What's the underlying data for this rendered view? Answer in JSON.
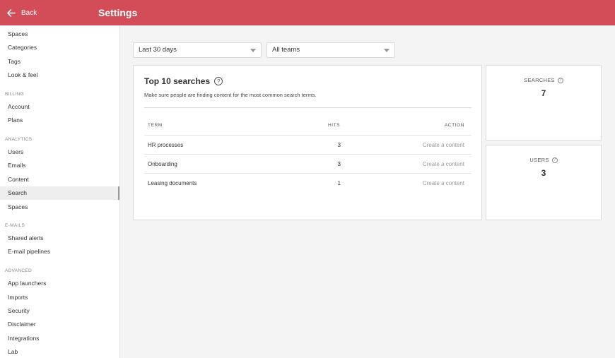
{
  "header": {
    "back_label": "Back",
    "title": "Settings"
  },
  "sidebar": {
    "general_items": [
      "Spaces",
      "Categories",
      "Tags",
      "Look & feel"
    ],
    "billing": {
      "label": "BILLING",
      "items": [
        "Account",
        "Plans"
      ]
    },
    "analytics": {
      "label": "ANALYTICS",
      "items": [
        "Users",
        "Emails",
        "Content",
        "Search",
        "Spaces"
      ]
    },
    "emails": {
      "label": "E-MAILS",
      "items": [
        "Shared alerts",
        "E-mail pipelines"
      ]
    },
    "advanced": {
      "label": "ADVANCED",
      "items": [
        "App launchers",
        "Imports",
        "Security",
        "Disclaimer",
        "Integrations",
        "Lab"
      ]
    },
    "active_item": "Search"
  },
  "filters": {
    "period": "Last 30 days",
    "team": "All teams"
  },
  "top_searches": {
    "title": "Top 10 searches",
    "subtitle": "Make sure people are finding content for the most common search terms.",
    "columns": {
      "term": "TERM",
      "hits": "HITS",
      "action": "ACTION"
    },
    "rows": [
      {
        "term": "HR processes",
        "hits": "3",
        "action": "Create a content"
      },
      {
        "term": "Onboarding",
        "hits": "3",
        "action": "Create a content"
      },
      {
        "term": "Leasing documents",
        "hits": "1",
        "action": "Create a content"
      }
    ]
  },
  "stats": {
    "searches": {
      "label": "SEARCHES",
      "value": "7"
    },
    "users": {
      "label": "USERS",
      "value": "3"
    }
  },
  "colors": {
    "brand": "#d24d57"
  }
}
